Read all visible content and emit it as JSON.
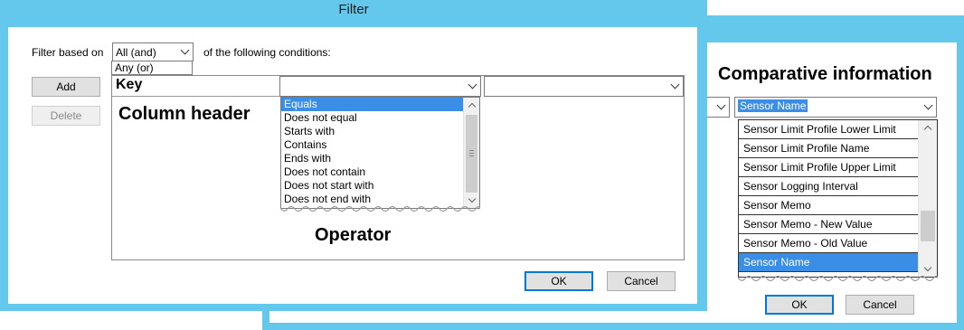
{
  "filter_window": {
    "title": "Filter",
    "filter_based_on_label": "Filter based on",
    "mode_combo": {
      "selected": "All (and)",
      "dropdown_option": "Any (or)"
    },
    "conditions_label": "of the following conditions:",
    "add_button": "Add",
    "delete_button": "Delete",
    "column_combo_value": "Key",
    "operator_dropdown": {
      "items": [
        "Equals",
        "Does not equal",
        "Starts with",
        "Contains",
        "Ends with",
        "Does not contain",
        "Does not start with",
        "Does not end with"
      ],
      "selected_index": 0
    },
    "ok_button": "OK",
    "cancel_button": "Cancel"
  },
  "annotations": {
    "column_header": "Column header",
    "operator": "Operator",
    "comparative_information": "Comparative information"
  },
  "comparative_window": {
    "combo_value": "Sensor Name",
    "list_items": [
      "Sensor Limit Profile Lower Limit",
      "Sensor Limit Profile Name",
      "Sensor Limit Profile Upper Limit",
      "Sensor Logging Interval",
      "Sensor Memo",
      "Sensor Memo - New Value",
      "Sensor Memo - Old Value",
      "Sensor Name"
    ],
    "selected_index": 7,
    "ok_button": "OK",
    "cancel_button": "Cancel"
  },
  "colors": {
    "window_frame": "#64c8ec",
    "selection": "#3a8ee6",
    "default_button_border": "#0078d7"
  }
}
